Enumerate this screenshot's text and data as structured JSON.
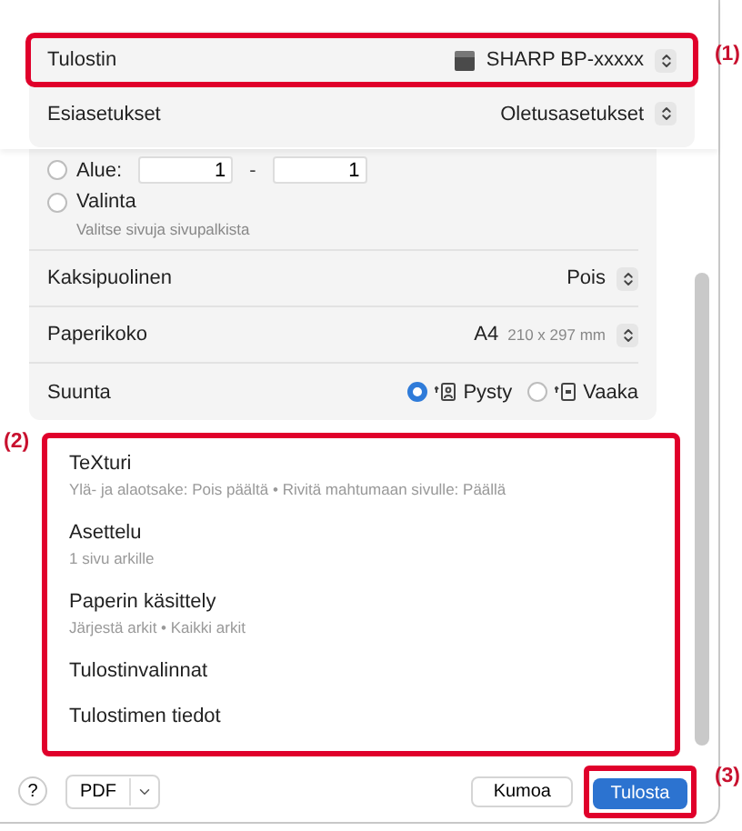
{
  "printer": {
    "label": "Tulostin",
    "value": "SHARP BP-xxxxx",
    "callout": "(1)"
  },
  "presets": {
    "label": "Esiasetukset",
    "value": "Oletusasetukset"
  },
  "page_range": [
    {
      "kind": "range",
      "label": "Alue:",
      "selected": false,
      "from": "1",
      "separator": "-",
      "to": "1"
    },
    {
      "kind": "option",
      "label": "Valinta",
      "selected": false,
      "hint": "Valitse sivuja sivupalkista"
    }
  ],
  "settings": [
    {
      "kind": "popup",
      "label": "Kaksipuolinen",
      "value": "Pois"
    },
    {
      "kind": "popup",
      "label": "Paperikoko",
      "value": "A4",
      "detail": "210 x 297 mm"
    },
    {
      "kind": "radio",
      "label": "Suunta",
      "options": [
        {
          "label": "Pysty",
          "selected": true
        },
        {
          "label": "Vaaka",
          "selected": false
        }
      ]
    }
  ],
  "sections": {
    "callout": "(2)",
    "items": [
      {
        "title": "TeXturi",
        "summary": "Ylä- ja alaotsake: Pois päältä • Rivitä mahtumaan sivulle: Päällä"
      },
      {
        "title": "Asettelu",
        "summary": "1 sivu arkille"
      },
      {
        "title": "Paperin käsittely",
        "summary": "Järjestä arkit • Kaikki arkit"
      },
      {
        "title": "Tulostinvalinnat"
      },
      {
        "title": "Tulostimen tiedot"
      }
    ]
  },
  "footer": {
    "help": "?",
    "pdf": "PDF",
    "cancel": "Kumoa",
    "print": "Tulosta",
    "print_callout": "(3)"
  }
}
